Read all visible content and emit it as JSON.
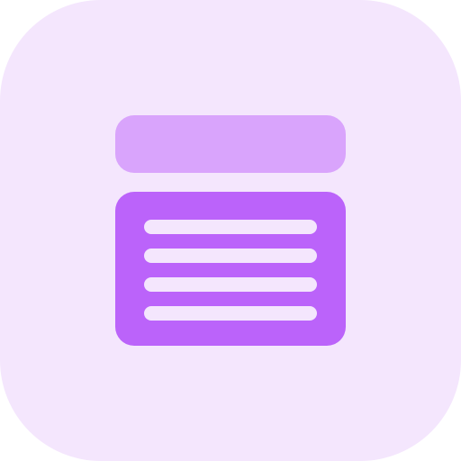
{
  "icon": {
    "name": "document-list-icon",
    "colors": {
      "tile_background": "#f4e6fd",
      "header_bar": "#d9a4fc",
      "content_panel": "#bb63fa",
      "text_lines": "#f4e6fd"
    },
    "line_count": 4
  }
}
